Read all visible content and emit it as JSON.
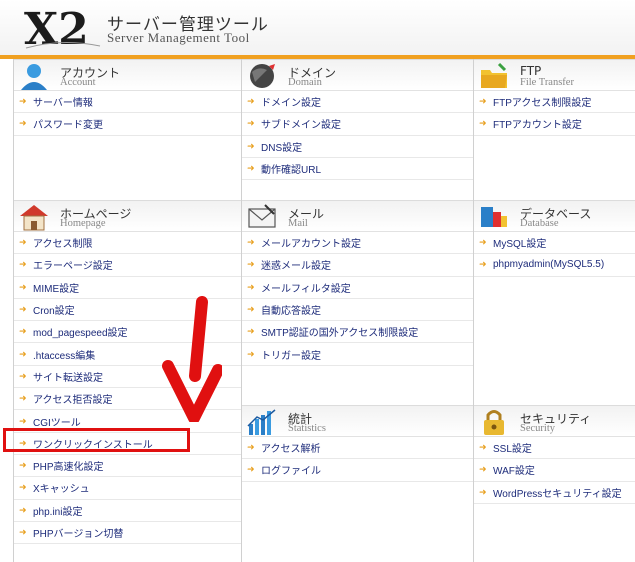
{
  "header": {
    "title_jp": "サーバー管理ツール",
    "title_en": "Server Management Tool",
    "logo_text": "X2"
  },
  "sections": {
    "account": {
      "title_jp": "アカウント",
      "title_en": "Account",
      "icon": "user-icon",
      "items": [
        "サーバー情報",
        "パスワード変更"
      ]
    },
    "domain": {
      "title_jp": "ドメイン",
      "title_en": "Domain",
      "icon": "globe-icon",
      "items": [
        "ドメイン設定",
        "サブドメイン設定",
        "DNS設定",
        "動作確認URL"
      ]
    },
    "ftp": {
      "title_jp": "FTP",
      "title_en": "File Transfer",
      "icon": "folder-icon",
      "items": [
        "FTPアクセス制限設定",
        "FTPアカウント設定"
      ]
    },
    "homepage": {
      "title_jp": "ホームページ",
      "title_en": "Homepage",
      "icon": "house-icon",
      "items": [
        "アクセス制限",
        "エラーページ設定",
        "MIME設定",
        "Cron設定",
        "mod_pagespeed設定",
        ".htaccess編集",
        "サイト転送設定",
        "アクセス拒否設定",
        "CGIツール",
        "ワンクリックインストール",
        "PHP高速化設定",
        "Xキャッシュ",
        "php.ini設定",
        "PHPバージョン切替"
      ]
    },
    "mail": {
      "title_jp": "メール",
      "title_en": "Mail",
      "icon": "mail-icon",
      "items": [
        "メールアカウント設定",
        "迷惑メール設定",
        "メールフィルタ設定",
        "自動応答設定",
        "SMTP認証の国外アクセス制限設定",
        "トリガー設定"
      ]
    },
    "database": {
      "title_jp": "データベース",
      "title_en": "Database",
      "icon": "database-icon",
      "items": [
        "MySQL設定",
        "phpmyadmin(MySQL5.5)"
      ]
    },
    "statistics": {
      "title_jp": "統計",
      "title_en": "Statistics",
      "icon": "chart-icon",
      "items": [
        "アクセス解析",
        "ログファイル"
      ]
    },
    "security": {
      "title_jp": "セキュリティ",
      "title_en": "Security",
      "icon": "lock-icon",
      "items": [
        "SSL設定",
        "WAF設定",
        "WordPressセキュリティ設定"
      ]
    }
  },
  "colors": {
    "accent": "#f0a020",
    "link": "#1d2b7a",
    "highlight": "#e01010"
  }
}
